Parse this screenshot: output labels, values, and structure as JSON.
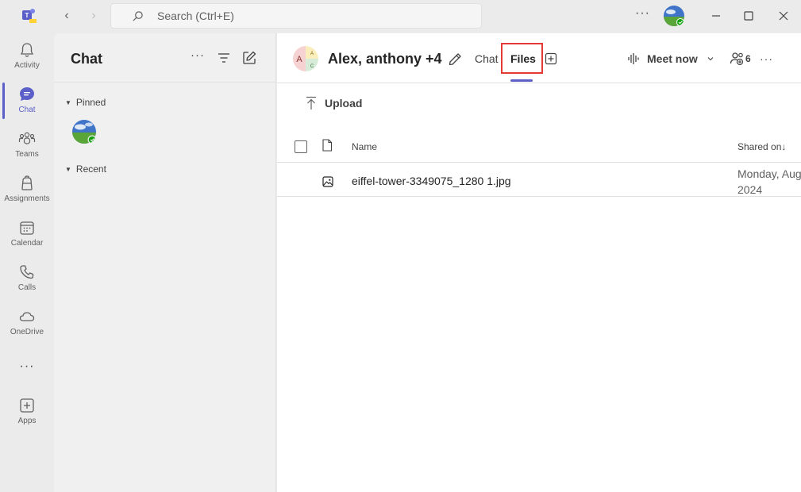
{
  "search": {
    "placeholder": "Search (Ctrl+E)"
  },
  "titlebar": {
    "more": "···"
  },
  "rail": [
    {
      "label": "Activity"
    },
    {
      "label": "Chat"
    },
    {
      "label": "Teams"
    },
    {
      "label": "Assignments"
    },
    {
      "label": "Calendar"
    },
    {
      "label": "Calls"
    },
    {
      "label": "OneDrive"
    },
    {
      "label": "···"
    },
    {
      "label": "Apps"
    }
  ],
  "chatlist": {
    "title": "Chat",
    "more": "···",
    "sections": {
      "pinned": "Pinned",
      "recent": "Recent"
    }
  },
  "conversation": {
    "title": "Alex, anthony +4",
    "avatar_letters": [
      "A",
      "A",
      "C"
    ],
    "tabs": {
      "chat": "Chat",
      "files": "Files"
    },
    "meet_now": "Meet now",
    "participants": "6",
    "more": "···"
  },
  "files": {
    "upload_label": "Upload",
    "columns": {
      "name": "Name",
      "shared_on": "Shared on"
    },
    "rows": [
      {
        "name": "eiffel-tower-3349075_1280 1.jpg",
        "shared_on_line1": "Monday, Aug",
        "shared_on_line2": "2024"
      }
    ]
  },
  "colors": {
    "accent": "#5b5fc7",
    "highlight": "#e53935"
  }
}
